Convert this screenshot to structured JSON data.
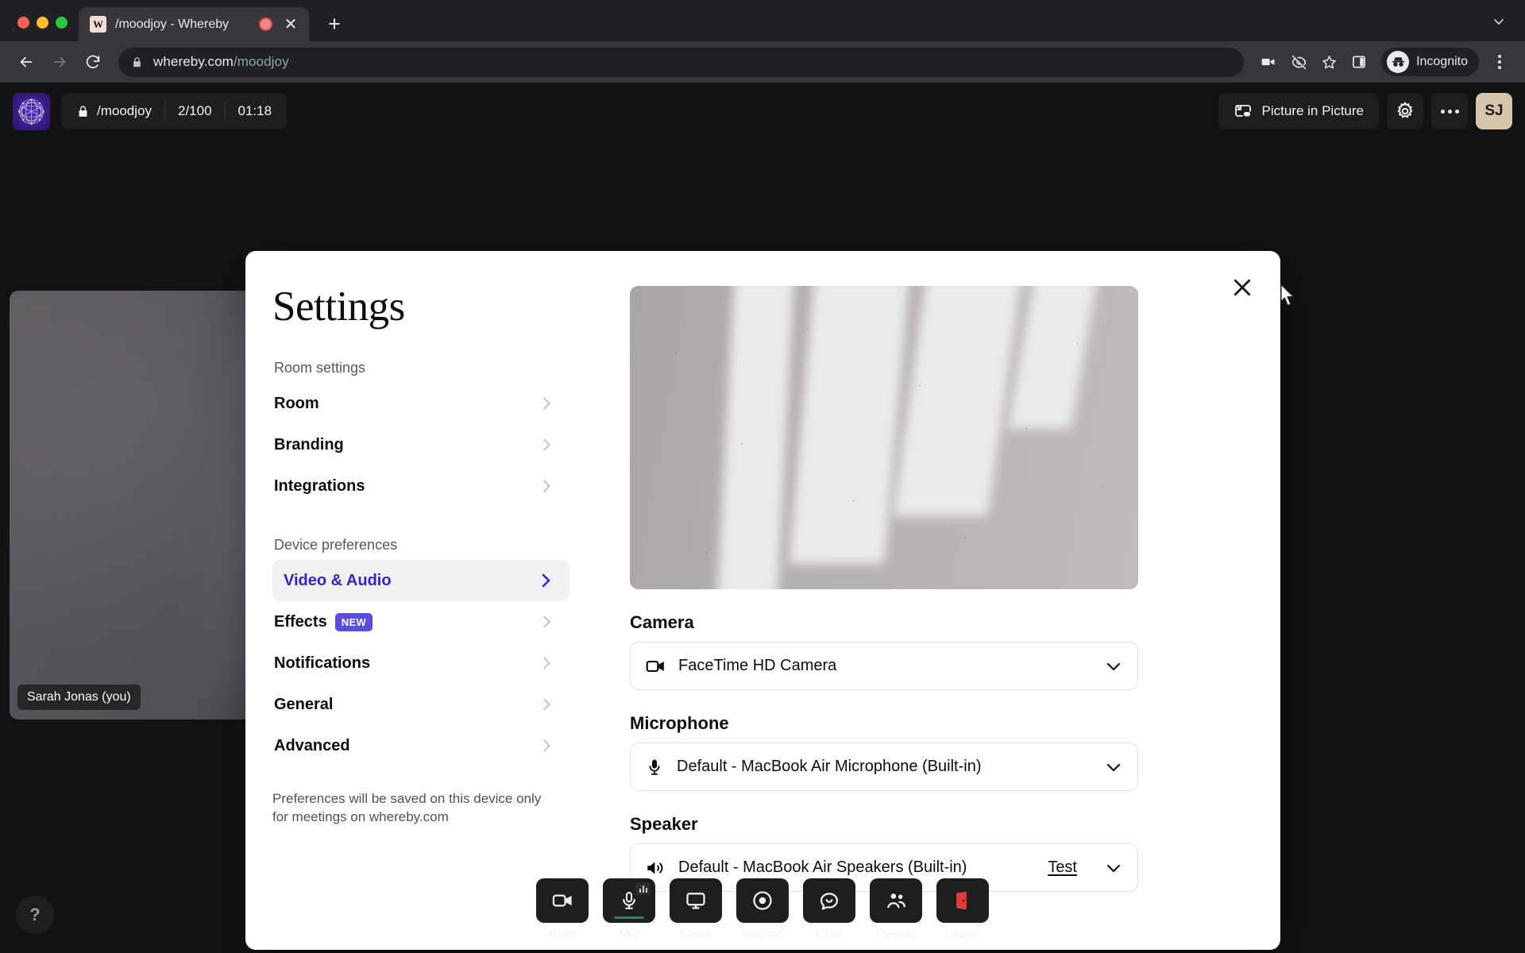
{
  "browser": {
    "tab": {
      "title": "/moodjoy - Whereby",
      "favicon_letter": "W",
      "recording_indicator": "recording-indicator",
      "close_label": "✕"
    },
    "new_tab_label": "+",
    "tabstrip_menu_icon": "chevron-down-icon",
    "nav": {
      "back_icon": "back-arrow-icon",
      "forward_icon": "forward-arrow-icon",
      "reload_icon": "reload-icon"
    },
    "omnibox": {
      "lock_icon": "lock-icon",
      "domain": "whereby.com",
      "path": "/moodjoy"
    },
    "toolbar_icons": [
      "camera-icon",
      "eye-off-icon",
      "star-icon",
      "side-panel-icon"
    ],
    "incognito_label": "Incognito",
    "menu_icon": "kebab-menu-icon"
  },
  "app": {
    "logo": "whereby-logo-icon",
    "room": {
      "lock_icon": "lock-icon",
      "name": "/moodjoy",
      "participants": "2/100",
      "timer": "01:18"
    },
    "header_actions": {
      "pip_label": "Picture in Picture",
      "pip_icon": "picture-in-picture-icon",
      "settings_icon": "gear-icon",
      "more_icon": "more-options-icon",
      "avatar_initials": "SJ"
    },
    "participant": {
      "name_tag": "Sarah Jonas (you)"
    },
    "help_label": "?",
    "controls": [
      {
        "label": "Cam",
        "icon": "camera-icon",
        "state": "on"
      },
      {
        "label": "Mic",
        "icon": "microphone-icon",
        "state": "active"
      },
      {
        "label": "Share",
        "icon": "screen-share-icon",
        "state": "off"
      },
      {
        "label": "Record",
        "icon": "record-icon",
        "state": "off"
      },
      {
        "label": "Chat",
        "icon": "chat-bubble-icon",
        "state": "off"
      },
      {
        "label": "People",
        "icon": "people-icon",
        "state": "off"
      },
      {
        "label": "Leave",
        "icon": "leave-door-icon",
        "state": "danger"
      }
    ]
  },
  "modal": {
    "title": "Settings",
    "close_icon": "close-icon",
    "sections": [
      {
        "label": "Room settings",
        "items": [
          {
            "label": "Room",
            "active": false,
            "badge": null
          },
          {
            "label": "Branding",
            "active": false,
            "badge": null
          },
          {
            "label": "Integrations",
            "active": false,
            "badge": null
          }
        ]
      },
      {
        "label": "Device preferences",
        "items": [
          {
            "label": "Video & Audio",
            "active": true,
            "badge": null
          },
          {
            "label": "Effects",
            "active": false,
            "badge": "NEW"
          },
          {
            "label": "Notifications",
            "active": false,
            "badge": null
          },
          {
            "label": "General",
            "active": false,
            "badge": null
          },
          {
            "label": "Advanced",
            "active": false,
            "badge": null
          }
        ]
      }
    ],
    "footnote": "Preferences will be saved on this device only for meetings on whereby.com",
    "preview": "self-video-preview",
    "fields": [
      {
        "label": "Camera",
        "icon": "camera-icon",
        "value": "FaceTime HD Camera",
        "action": null,
        "chevron": "chevron-down-icon"
      },
      {
        "label": "Microphone",
        "icon": "microphone-icon",
        "value": "Default - MacBook Air Microphone (Built-in)",
        "action": null,
        "chevron": "chevron-down-icon"
      },
      {
        "label": "Speaker",
        "icon": "speaker-icon",
        "value": "Default - MacBook Air Speakers (Built-in)",
        "action": "Test",
        "chevron": "chevron-down-icon"
      }
    ]
  },
  "colors": {
    "accent_indigo": "#3b22c4",
    "badge_new": "#5b4ce0",
    "danger_red": "#e23a3a",
    "avatar_bg": "#d6c5ac",
    "chrome_dark": "#202124",
    "app_bg": "#121212"
  }
}
